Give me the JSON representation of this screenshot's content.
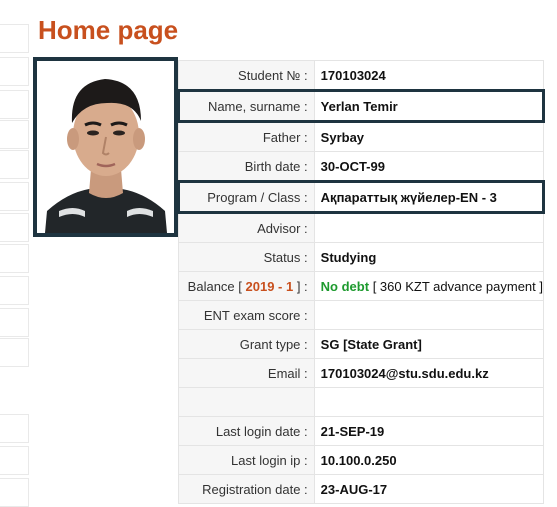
{
  "page": {
    "title": "Home page"
  },
  "photo": {
    "alt": "Student photo"
  },
  "profile": {
    "student_no_label": "Student №",
    "student_no": "170103024",
    "name_label": "Name, surname",
    "name": "Yerlan Temir",
    "father_label": "Father",
    "father": "Syrbay",
    "birth_label": "Birth date",
    "birth": "30-OCT-99",
    "program_label": "Program / Class",
    "program": "Ақпараттық жүйелер-EN - 3",
    "advisor_label": "Advisor",
    "advisor": "",
    "status_label": "Status",
    "status": "Studying",
    "balance_label": "Balance",
    "balance_period": "2019 - 1",
    "balance_status": "No debt",
    "balance_detail": "[ 360 KZT advance payment ]",
    "ent_label": "ENT exam score",
    "ent": "",
    "grant_label": "Grant type",
    "grant": "SG [State Grant]",
    "email_label": "Email",
    "email": "170103024@stu.sdu.edu.kz",
    "last_login_date_label": "Last login date",
    "last_login_date": "21-SEP-19",
    "last_login_ip_label": "Last login ip",
    "last_login_ip": "10.100.0.250",
    "registration_date_label": "Registration date",
    "registration_date": "23-AUG-17"
  },
  "colors": {
    "title": "#c8501e",
    "frame": "#1e3440",
    "no_debt": "#1d9a2e"
  }
}
